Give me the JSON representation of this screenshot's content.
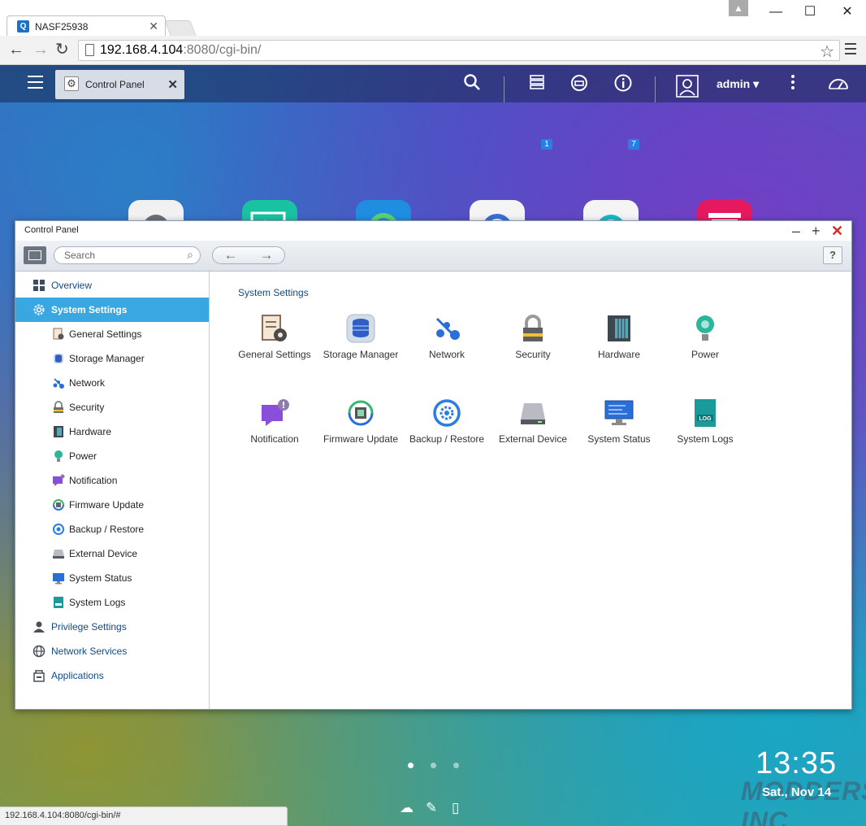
{
  "browser": {
    "tab_title": "NASF25938",
    "tab_favicon": "Q",
    "url_host": "192.168.4.104",
    "url_rest": ":8080/cgi-bin/",
    "status_url": "192.168.4.104:8080/cgi-bin/#"
  },
  "topbar": {
    "active_app_tab": "Control Panel",
    "tasks_badge": "1",
    "notifications_badge": "7",
    "user": "admin",
    "user_caret": "▾"
  },
  "window": {
    "title": "Control Panel",
    "search_placeholder": "Search",
    "help_label": "?"
  },
  "sidebar": {
    "items": [
      {
        "label": "Overview",
        "level": "top",
        "icon": "overview-icon"
      },
      {
        "label": "System Settings",
        "level": "top",
        "icon": "gear-icon",
        "active": true
      },
      {
        "label": "General Settings",
        "level": "sub",
        "icon": "general-settings-icon"
      },
      {
        "label": "Storage Manager",
        "level": "sub",
        "icon": "storage-icon"
      },
      {
        "label": "Network",
        "level": "sub",
        "icon": "network-icon"
      },
      {
        "label": "Security",
        "level": "sub",
        "icon": "lock-icon"
      },
      {
        "label": "Hardware",
        "level": "sub",
        "icon": "hardware-icon"
      },
      {
        "label": "Power",
        "level": "sub",
        "icon": "power-bulb-icon"
      },
      {
        "label": "Notification",
        "level": "sub",
        "icon": "notification-icon"
      },
      {
        "label": "Firmware Update",
        "level": "sub",
        "icon": "firmware-icon"
      },
      {
        "label": "Backup / Restore",
        "level": "sub",
        "icon": "backup-icon"
      },
      {
        "label": "External Device",
        "level": "sub",
        "icon": "external-device-icon"
      },
      {
        "label": "System Status",
        "level": "sub",
        "icon": "monitor-icon"
      },
      {
        "label": "System Logs",
        "level": "sub",
        "icon": "log-icon"
      },
      {
        "label": "Privilege Settings",
        "level": "top",
        "icon": "user-icon"
      },
      {
        "label": "Network Services",
        "level": "top",
        "icon": "globe-icon"
      },
      {
        "label": "Applications",
        "level": "top",
        "icon": "applications-icon"
      }
    ]
  },
  "main": {
    "section_title": "System Settings",
    "apps": [
      {
        "label": "General Settings",
        "icon": "general-settings-icon"
      },
      {
        "label": "Storage Manager",
        "icon": "storage-icon"
      },
      {
        "label": "Network",
        "icon": "network-icon"
      },
      {
        "label": "Security",
        "icon": "lock-icon"
      },
      {
        "label": "Hardware",
        "icon": "hardware-icon"
      },
      {
        "label": "Power",
        "icon": "power-bulb-icon"
      },
      {
        "label": "Notification",
        "icon": "notification-icon"
      },
      {
        "label": "Firmware Update",
        "icon": "firmware-icon"
      },
      {
        "label": "Backup / Restore",
        "icon": "backup-icon"
      },
      {
        "label": "External Device",
        "icon": "external-device-icon"
      },
      {
        "label": "System Status",
        "icon": "monitor-icon"
      },
      {
        "label": "System Logs",
        "icon": "log-icon"
      }
    ]
  },
  "desktop": {
    "clock": "13:35",
    "date": "Sat., Nov 14",
    "watermark": "MODDERS INC"
  },
  "colors": {
    "accent": "#39a7e2",
    "link": "#134a86",
    "close": "#d42a2a",
    "badge": "#2a7de1"
  }
}
